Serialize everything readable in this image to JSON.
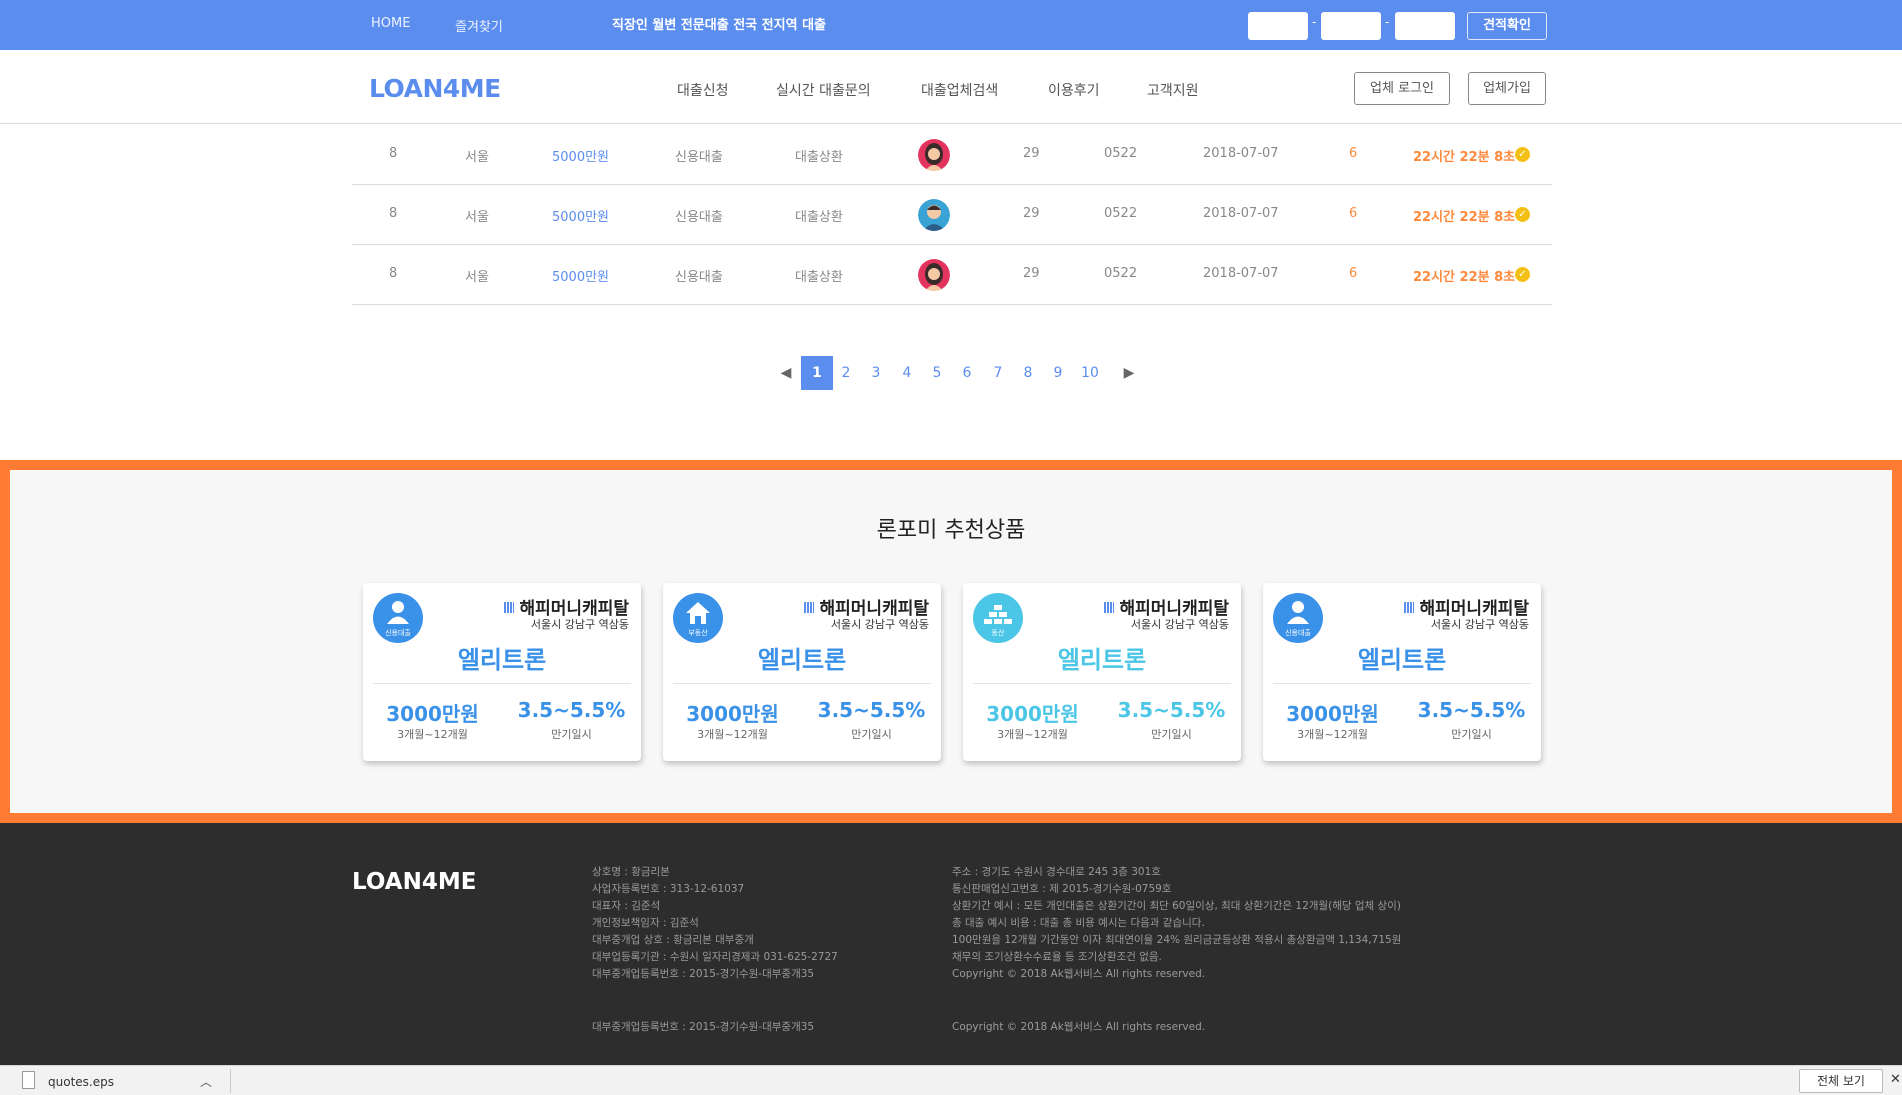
{
  "topbar": {
    "nav": [
      "HOME",
      "즐겨찾기"
    ],
    "slogan": "직장인 월변 전문대출 전국 전지역 대출",
    "phone_separator": "-",
    "check_button": "견적확인"
  },
  "header": {
    "logo": "LOAN4ME",
    "menu": [
      "대출신청",
      "실시간 대출문의",
      "대출업체검색",
      "이용후기",
      "고객지원"
    ],
    "login_button": "업체 로그인",
    "join_button": "업체가입"
  },
  "table": {
    "rows": [
      {
        "no": "8",
        "region": "서울",
        "amount": "5000만원",
        "type": "신용대출",
        "purpose": "대출상환",
        "avatar": "female-avatar-icon",
        "age": "29",
        "code": "0522",
        "date": "2018-07-07",
        "count": "6",
        "remaining": "22시간 22분 8초"
      },
      {
        "no": "8",
        "region": "서울",
        "amount": "5000만원",
        "type": "신용대출",
        "purpose": "대출상환",
        "avatar": "male-avatar-icon",
        "age": "29",
        "code": "0522",
        "date": "2018-07-07",
        "count": "6",
        "remaining": "22시간 22분 8초"
      },
      {
        "no": "8",
        "region": "서울",
        "amount": "5000만원",
        "type": "신용대출",
        "purpose": "대출상환",
        "avatar": "female-avatar-icon",
        "age": "29",
        "code": "0522",
        "date": "2018-07-07",
        "count": "6",
        "remaining": "22시간 22분 8초"
      }
    ]
  },
  "pagination": {
    "prev": "◀",
    "next": "▶",
    "pages": [
      "1",
      "2",
      "3",
      "4",
      "5",
      "6",
      "7",
      "8",
      "9",
      "10"
    ],
    "current": "1"
  },
  "recommended": {
    "title": "론포미 추천상품",
    "cards": [
      {
        "badge_icon": "person-icon",
        "badge_label": "신용대출",
        "company": "해피머니캐피탈",
        "address": "서울시 강남구 역삼동",
        "product": "엘리트론",
        "amount": "3000만원",
        "term": "3개월~12개월",
        "rate": "3.5~5.5%",
        "repayment": "만기일시",
        "badge_color": "#3a91e8"
      },
      {
        "badge_icon": "house-icon",
        "badge_label": "부동산",
        "company": "해피머니캐피탈",
        "address": "서울시 강남구 역삼동",
        "product": "엘리트론",
        "amount": "3000만원",
        "term": "3개월~12개월",
        "rate": "3.5~5.5%",
        "repayment": "만기일시",
        "badge_color": "#3a91e8"
      },
      {
        "badge_icon": "gold-bars-icon",
        "badge_label": "동산",
        "company": "해피머니캐피탈",
        "address": "서울시 강남구 역삼동",
        "product": "엘리트론",
        "amount": "3000만원",
        "term": "3개월~12개월",
        "rate": "3.5~5.5%",
        "repayment": "만기일시",
        "badge_color": "#4cc6e6"
      },
      {
        "badge_icon": "person-icon",
        "badge_label": "신용대출",
        "company": "해피머니캐피탈",
        "address": "서울시 강남구 역삼동",
        "product": "엘리트론",
        "amount": "3000만원",
        "term": "3개월~12개월",
        "rate": "3.5~5.5%",
        "repayment": "만기일시",
        "badge_color": "#3a91e8"
      }
    ]
  },
  "footer": {
    "logo": "LOAN4ME",
    "company_info": [
      "상호명 : 황금리본",
      "사업자등록번호 : 313-12-61037",
      "대표자 : 김준석",
      "개인정보책임자 : 김준석",
      "대부중개업 상호 : 황금리본 대부중개",
      "대부업등록기관 : 수원시 일자리경제과 031-625-2727",
      "대부중개업등록번호 : 2015-경기수원-대부중개35"
    ],
    "legal_info": [
      "주소 : 경기도 수원시 경수대로 245 3층 301호",
      "통신판매업신고번호 : 제 2015-경기수원-0759호",
      "상환기간 예시 : 모든 개인대출은 상환기간이 최단 60일이상, 최대 상환기간은 12개월(해당 업체 상이)",
      "총 대출 예시 비용 : 대출 총 비용 예시는 다음과 같습니다.",
      "100만원을 12개월 기간동안 이자 최대연이율 24% 원리금균등상환 적용시 총상환금액 1,134,715원",
      "채무의 조기상환수수료율 등 조기상환조건 없음.",
      "Copyright © 2018 Ak웹서비스 All rights reserved."
    ],
    "bottom_left": "대부중개업등록번호 : 2015-경기수원-대부중개35",
    "bottom_right": "Copyright © 2018 Ak웹서비스 All rights reserved."
  },
  "download_bar": {
    "file_name": "quotes.eps",
    "show_all": "전체 보기",
    "close": "✕"
  },
  "colors": {
    "accent": "#5b8def",
    "highlight_border": "#ff7a33",
    "time_orange": "#ff8a3d",
    "footer_bg": "#2d2d2d"
  }
}
